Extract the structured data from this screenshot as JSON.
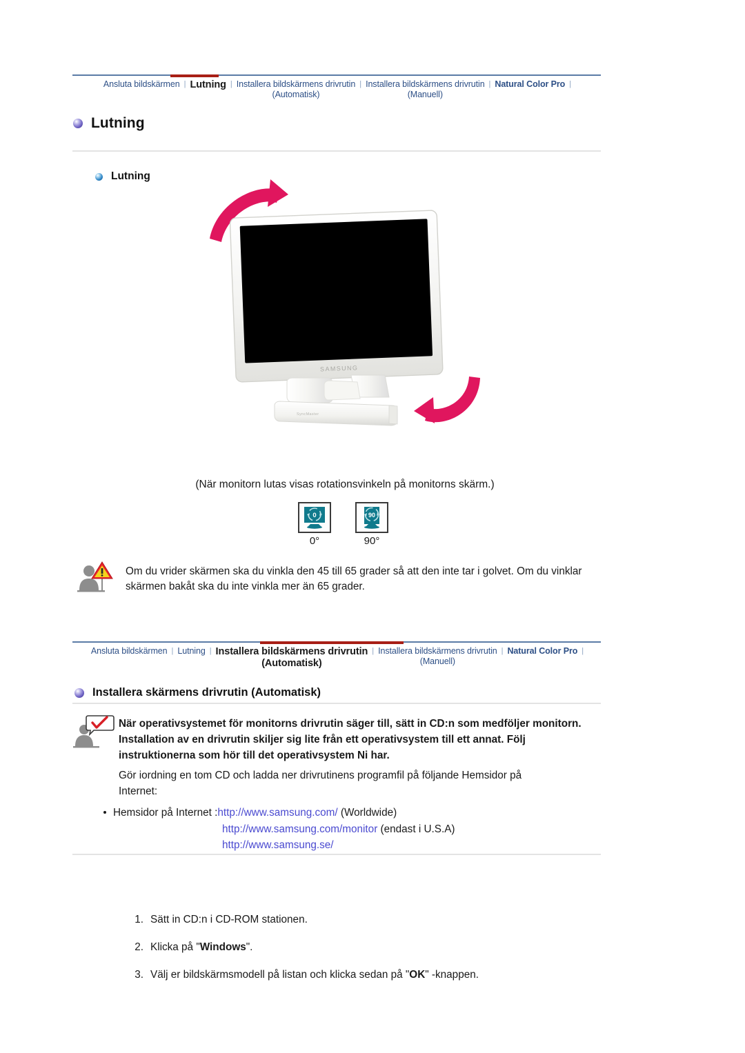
{
  "nav_top": {
    "items": [
      {
        "label": "Ansluta bildskärmen",
        "state": "link"
      },
      {
        "label": "Lutning",
        "state": "active"
      },
      {
        "label": "Installera bildskärmens drivrutin\n(Automatisk)",
        "state": "link"
      },
      {
        "label": "Installera bildskärmens drivrutin\n(Manuell)",
        "state": "link"
      },
      {
        "label": "Natural Color Pro",
        "state": "semi"
      }
    ],
    "separator": "|",
    "rule_color": "#5a7ba6",
    "active_marker_color": "#a81f16"
  },
  "nav_bottom": {
    "items": [
      {
        "label": "Ansluta bildskärmen",
        "state": "link"
      },
      {
        "label": "Lutning",
        "state": "link"
      },
      {
        "label": "Installera bildskärmens drivrutin\n(Automatisk)",
        "state": "active"
      },
      {
        "label": "Installera bildskärmens drivrutin\n(Manuell)",
        "state": "link"
      },
      {
        "label": "Natural Color Pro",
        "state": "semi"
      }
    ],
    "separator": "|",
    "rule_color": "#5a7ba6",
    "active_marker_color": "#a81f16"
  },
  "section1": {
    "heading": "Lutning",
    "subheading": "Lutning",
    "caption": "(När monitorn lutas visas rotationsvinkeln på monitorns skärm.)",
    "angles": [
      {
        "icon_text": "0°",
        "label": "0°"
      },
      {
        "icon_text": "90°",
        "label": "90°"
      }
    ],
    "warning": "Om du vrider skärmen ska du vinkla den 45 till 65 grader så att den inte tar i golvet. Om du vinklar skärmen bakåt ska du inte vinkla mer än 65 grader.",
    "monitor_brand": "SAMSUNG"
  },
  "section2": {
    "heading": "Installera skärmens drivrutin (Automatisk)",
    "note": "När operativsystemet för monitorns drivrutin säger till, sätt in CD:n som medföljer monitorn. Installation av en drivrutin skiljer sig lite från ett operativsystem till ett annat. Följ instruktionerna som hör till det operativsystem Ni har.",
    "paragraph": "Gör iordning en tom CD och ladda ner drivrutinens programfil på följande Hemsidor på Internet:",
    "links_label": "Hemsidor på Internet :",
    "links": [
      {
        "url": "http://www.samsung.com/",
        "suffix": " (Worldwide)"
      },
      {
        "url": "http://www.samsung.com/monitor",
        "suffix": " (endast i U.S.A)"
      },
      {
        "url": "http://www.samsung.se/",
        "suffix": ""
      }
    ],
    "link_color": "#4a4ad0",
    "steps": [
      {
        "num": "1.",
        "pre": "Sätt in CD:n i CD-ROM stationen.",
        "kw": "",
        "post": ""
      },
      {
        "num": "2.",
        "pre": "Klicka på \"",
        "kw": "Windows",
        "post": "\"."
      },
      {
        "num": "3.",
        "pre": "Välj er bildskärmsmodell på listan och klicka sedan på \"",
        "kw": "OK",
        "post": "\" -knappen."
      }
    ]
  }
}
